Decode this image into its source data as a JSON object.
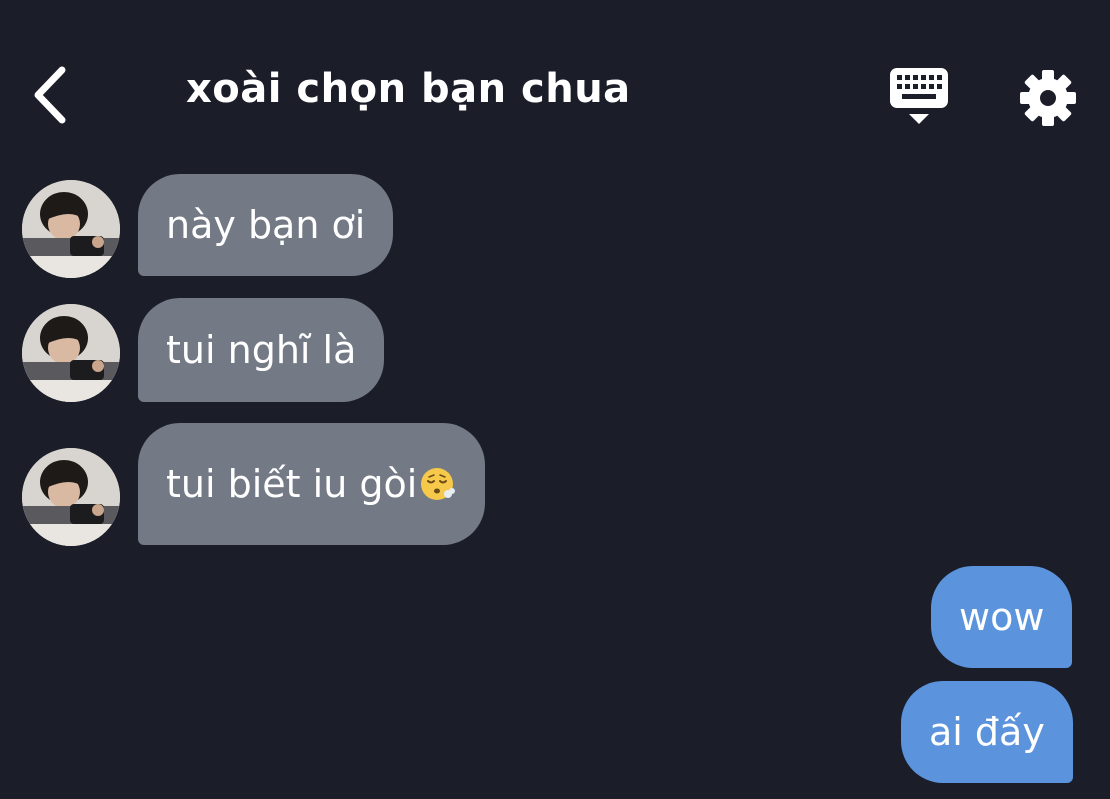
{
  "header": {
    "title": "xoài chọn bạn chua",
    "back_icon": "chevron-left-icon",
    "keyboard_icon": "keyboard-icon",
    "settings_icon": "gear-icon"
  },
  "messages": [
    {
      "side": "incoming",
      "text": "này bạn ơi",
      "avatar": "contact-avatar"
    },
    {
      "side": "incoming",
      "text": "tui nghĩ là",
      "avatar": "contact-avatar"
    },
    {
      "side": "incoming",
      "text": "tui biết iu gòi",
      "emoji": "face-exhaling-emoji",
      "avatar": "contact-avatar"
    },
    {
      "side": "outgoing",
      "text": "wow"
    },
    {
      "side": "outgoing",
      "text": "ai đấy"
    }
  ],
  "colors": {
    "background": "#1b1e29",
    "incoming_bubble": "#737985",
    "outgoing_bubble": "#5b93dd",
    "text": "#ffffff"
  }
}
